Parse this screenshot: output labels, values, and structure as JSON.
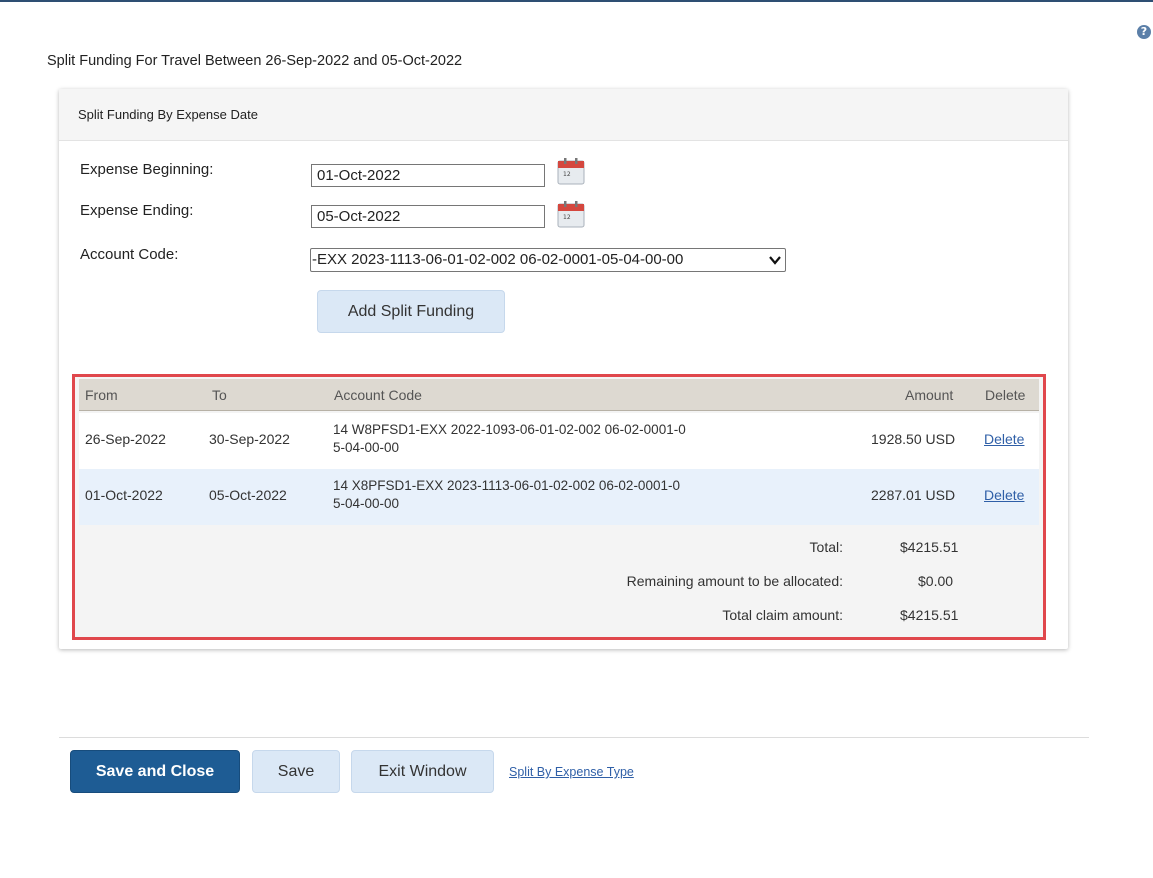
{
  "page": {
    "title": "Split Funding For Travel Between 26-Sep-2022 and 05-Oct-2022",
    "help_glyph": "?"
  },
  "panel": {
    "header": "Split Funding By Expense Date",
    "form": {
      "expense_beginning_label": "Expense Beginning:",
      "expense_beginning_value": "01-Oct-2022",
      "expense_ending_label": "Expense Ending:",
      "expense_ending_value": "05-Oct-2022",
      "account_code_label": "Account Code:",
      "account_code_selected": "-EXX 2023-1113-06-01-02-002 06-02-0001-05-04-00-00",
      "add_button": "Add Split Funding",
      "calendar_icon_text": "12"
    },
    "table": {
      "headers": {
        "from": "From",
        "to": "To",
        "account_code": "Account Code",
        "amount": "Amount",
        "delete": "Delete"
      },
      "rows": [
        {
          "from": "26-Sep-2022",
          "to": "30-Sep-2022",
          "account_code_line1": "14 W8PFSD1-EXX 2022-1093-06-01-02-002 06-02-0001-0",
          "account_code_line2": "5-04-00-00",
          "amount": "1928.50 USD",
          "delete": "Delete"
        },
        {
          "from": "01-Oct-2022",
          "to": "05-Oct-2022",
          "account_code_line1": "14 X8PFSD1-EXX 2023-1113-06-01-02-002 06-02-0001-0",
          "account_code_line2": "5-04-00-00",
          "amount": "2287.01 USD",
          "delete": "Delete"
        }
      ],
      "summary": {
        "total_label": "Total:",
        "total_value": "$4215.51",
        "remaining_label": "Remaining amount to be allocated:",
        "remaining_value": "$0.00",
        "claim_label": "Total claim amount:",
        "claim_value": "$4215.51"
      }
    }
  },
  "footer": {
    "save_close": "Save and Close",
    "save": "Save",
    "exit": "Exit Window",
    "split_link": "Split By Expense Type"
  },
  "colors": {
    "primary_button": "#1e5c94",
    "light_button": "#dbe8f6",
    "highlight_border": "#e0474c",
    "link": "#2f5fa7",
    "table_header": "#ddd9d1"
  }
}
